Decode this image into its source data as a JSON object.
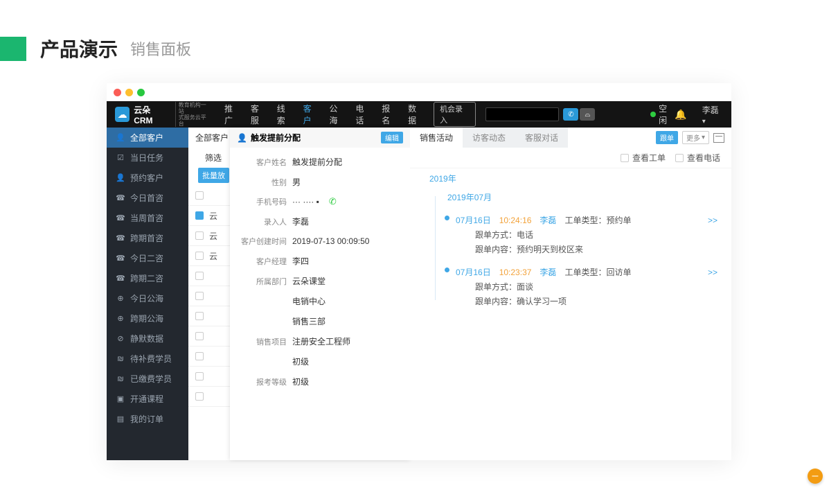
{
  "slide": {
    "title": "产品演示",
    "subtitle": "销售面板"
  },
  "topnav": {
    "logo_text": "云朵CRM",
    "logo_tag1": "教育机构一站",
    "logo_tag2": "式服务云平台",
    "items": [
      "推广",
      "客服",
      "线索",
      "客户",
      "公海",
      "电话",
      "报名",
      "数据"
    ],
    "active_index": 3,
    "chance_btn": "机会录入",
    "status": "空闲",
    "user": "李磊"
  },
  "sidebar": {
    "items": [
      {
        "icon": "👤",
        "label": "全部客户"
      },
      {
        "icon": "☑",
        "label": "当日任务"
      },
      {
        "icon": "👤",
        "label": "预约客户"
      },
      {
        "icon": "☎",
        "label": "今日首咨"
      },
      {
        "icon": "☎",
        "label": "当周首咨"
      },
      {
        "icon": "☎",
        "label": "跨期首咨"
      },
      {
        "icon": "☎",
        "label": "今日二咨"
      },
      {
        "icon": "☎",
        "label": "跨期二咨"
      },
      {
        "icon": "⊕",
        "label": "今日公海"
      },
      {
        "icon": "⊕",
        "label": "跨期公海"
      },
      {
        "icon": "⊘",
        "label": "静默数据"
      },
      {
        "icon": "₪",
        "label": "待补费学员"
      },
      {
        "icon": "₪",
        "label": "已缴费学员"
      },
      {
        "icon": "▣",
        "label": "开通课程"
      },
      {
        "icon": "▤",
        "label": "我的订单"
      }
    ],
    "active_index": 0
  },
  "main": {
    "head": "全部客户",
    "filter": "筛选",
    "batch_btn": "批量放",
    "rows": [
      "",
      "云",
      "云",
      "云",
      "",
      "",
      "",
      "",
      "",
      "",
      ""
    ]
  },
  "detail": {
    "title": "触发提前分配",
    "edit": "编辑",
    "fields": [
      {
        "label": "客户姓名",
        "value": "触发提前分配"
      },
      {
        "label": "性别",
        "value": "男"
      },
      {
        "label": "手机号码",
        "value": "··· ···· ▪",
        "phone": true
      },
      {
        "label": "录入人",
        "value": "李磊"
      },
      {
        "label": "客户创建时间",
        "value": "2019-07-13 00:09:50"
      },
      {
        "label": "客户经理",
        "value": "李四"
      },
      {
        "label": "所属部门",
        "value": "云朵课堂"
      },
      {
        "label": "",
        "value": "电销中心"
      },
      {
        "label": "",
        "value": "销售三部"
      },
      {
        "label": "销售项目",
        "value": "注册安全工程师"
      },
      {
        "label": "",
        "value": "初级"
      },
      {
        "label": "报考等级",
        "value": "初级"
      }
    ]
  },
  "activity": {
    "tabs": [
      "销售活动",
      "访客动态",
      "客服对话"
    ],
    "active_tab": 0,
    "follow_btn": "跟单",
    "more_btn": "更多",
    "check1": "查看工单",
    "check2": "查看电话",
    "year": "2019年",
    "month": "2019年07月",
    "entries": [
      {
        "date": "07月16日",
        "time": "10:24:16",
        "user": "李磊",
        "type_label": "工单类型：",
        "type_value": "预约单",
        "method_label": "跟单方式：",
        "method_value": "电话",
        "content_label": "跟单内容：",
        "content_value": "预约明天到校区来",
        "more": ">>"
      },
      {
        "date": "07月16日",
        "time": "10:23:37",
        "user": "李磊",
        "type_label": "工单类型：",
        "type_value": "回访单",
        "method_label": "跟单方式：",
        "method_value": "面谈",
        "content_label": "跟单内容：",
        "content_value": "确认学习一项",
        "more": ">>"
      }
    ]
  }
}
